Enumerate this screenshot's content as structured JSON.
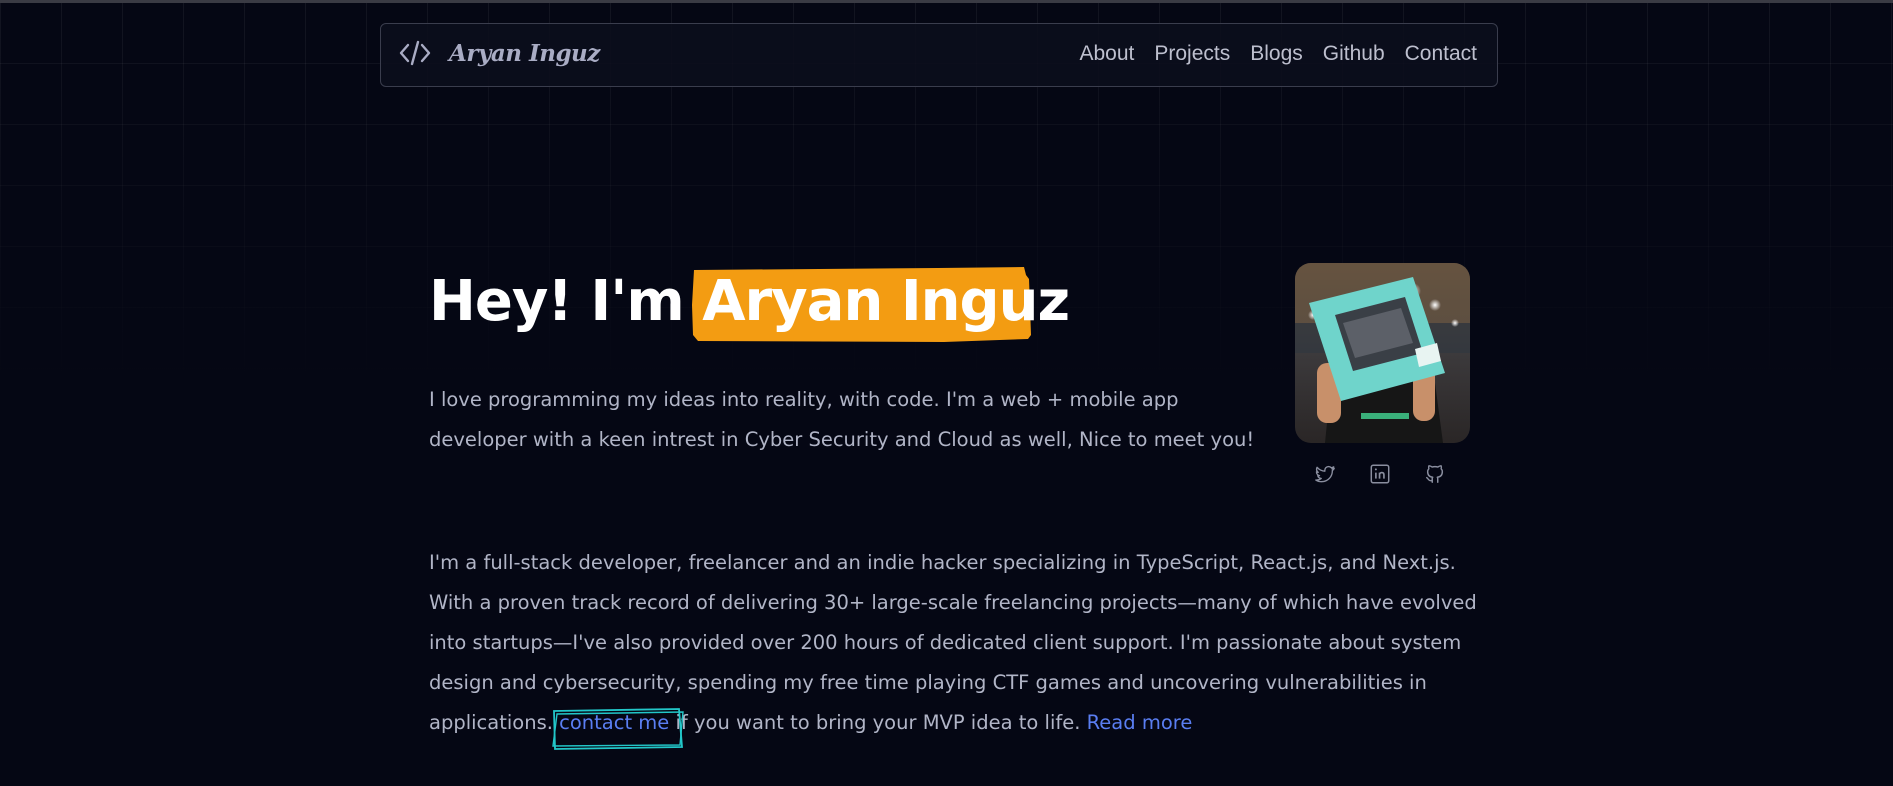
{
  "brand": {
    "name": "Aryan Inguz",
    "logo_icon": "code-brackets-icon"
  },
  "nav": {
    "links": [
      "About",
      "Projects",
      "Blogs",
      "Github",
      "Contact"
    ]
  },
  "hero": {
    "title_prefix": "Hey! I'm ",
    "title_name": "Aryan Inguz",
    "intro": "I love programming my ideas into reality, with code. I'm a web + mobile app developer with a keen intrest in Cyber Security and Cloud as well, Nice to meet you!"
  },
  "socials": [
    "twitter-icon",
    "linkedin-icon",
    "github-icon"
  ],
  "bio": {
    "text": "I'm a full-stack developer, freelancer and an indie hacker specializing in TypeScript, React.js, and Next.js. With a proven track record of delivering 30+ large-scale freelancing projects—many of which have evolved into startups—I've also provided over 200 hours of dedicated client support. I'm passionate about system design and cybersecurity, spending my free time playing CTF games and uncovering vulnerabilities in applications.",
    "contact_link": "contact me",
    "cta_text": " if you want to bring your MVP idea to life. ",
    "read_more": "Read more"
  },
  "colors": {
    "background": "#050714",
    "highlight": "#f39c12",
    "link": "#5a7ef2",
    "contact_outline": "#22c7c9"
  }
}
